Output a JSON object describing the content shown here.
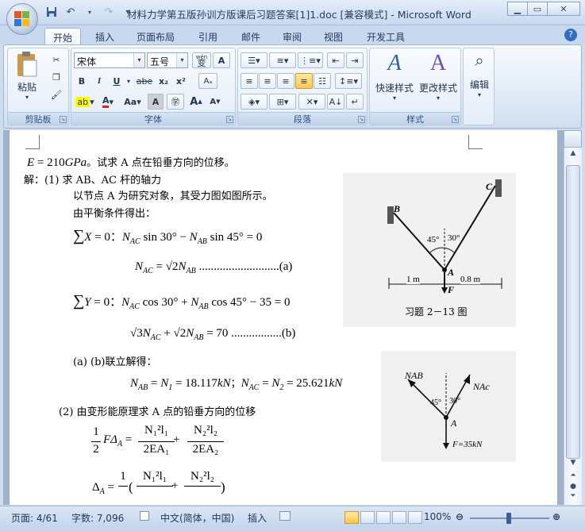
{
  "window": {
    "title": "材料力学第五版孙训方版课后习题答案[1]1.doc [兼容模式] - Microsoft Word"
  },
  "tabs": [
    "开始",
    "插入",
    "页面布局",
    "引用",
    "邮件",
    "审阅",
    "视图",
    "开发工具"
  ],
  "ribbon": {
    "clipboard": {
      "paste": "粘贴",
      "label": "剪贴板"
    },
    "font": {
      "family": "宋体",
      "size": "五号",
      "label": "字体",
      "wen": "wén",
      "wen_char": "变",
      "bold": "B",
      "italic": "I",
      "underline": "U",
      "strike": "abe",
      "sub": "x₂",
      "sup": "x²",
      "aa": "Aa",
      "grow": "A",
      "shrink": "A"
    },
    "paragraph": {
      "label": "段落"
    },
    "styles": {
      "quick": "快速样式",
      "change": "更改样式",
      "label": "样式"
    },
    "editing": {
      "label": "编辑"
    }
  },
  "document": {
    "line1_a": "E",
    "line1_b": " = 210",
    "line1_c": "GPa",
    "line1_d": "。试求 A 点在铅垂方向的位移。",
    "sol1": "解：(1) 求 AB、AC 杆的轴力",
    "sol2": "以节点 A 为研究对象，其受力图如图所示。",
    "sol3": "由平衡条件得出：",
    "eq1_a": "∑",
    "eq1_b": "X",
    "eq1_c": " = 0：",
    "eq1_d": "N",
    "eq1_e": "AC",
    "eq1_f": " sin 30° − ",
    "eq1_g": "N",
    "eq1_h": "AB",
    "eq1_i": " sin 45° = 0",
    "eq2_a": "N",
    "eq2_b": "AC",
    "eq2_c": " = √2",
    "eq2_d": "N",
    "eq2_e": "AB",
    "eq2_f": " ...........................(a)",
    "eq3_a": "∑",
    "eq3_b": "Y",
    "eq3_c": " = 0：",
    "eq3_d": "N",
    "eq3_e": "AC",
    "eq3_f": " cos 30° + ",
    "eq3_g": "N",
    "eq3_h": "AB",
    "eq3_i": " cos 45° − 35 = 0",
    "eq4_a": "√3",
    "eq4_b": "N",
    "eq4_c": "AC",
    "eq4_d": " + √2",
    "eq4_e": "N",
    "eq4_f": "AB",
    "eq4_g": " = 70 .................(b)",
    "sol4": "(a)  (b)联立解得：",
    "eq5_a": "N",
    "eq5_b": "AB",
    "eq5_c": " = ",
    "eq5_d": "N",
    "eq5_e": "1",
    "eq5_f": " = 18.117",
    "eq5_g": "kN",
    "eq5_h": "；",
    "eq5_i": "N",
    "eq5_j": "AC",
    "eq5_k": " = ",
    "eq5_l": "N",
    "eq5_m": "2",
    "eq5_n": " = 25.621",
    "eq5_o": "kN",
    "sol5": "(2) 由变形能原理求 A 点的铅垂方向的位移",
    "eq6_half": "1",
    "eq6_two": "2",
    "eq6_f": "FΔ",
    "eq6_fa": "A",
    "eq6_eq": " = ",
    "eq6_num1": "N₁²l₁",
    "eq6_den1": "2EA₁",
    "eq6_plus": " + ",
    "eq6_num2": "N₂²l₂",
    "eq6_den2": "2EA₂",
    "eq7_a": "Δ",
    "eq7_b": "A",
    "eq7_c": " = ",
    "eq7_one": "1",
    "eq7_open": "(",
    "eq7_num1": "N₁²l₁",
    "eq7_plus": " + ",
    "eq7_num2": "N₂²l₂",
    "eq7_close": ")"
  },
  "figure1": {
    "B": "B",
    "C": "C",
    "A": "A",
    "F": "F",
    "ang1": "45°",
    "ang2": "30°",
    "dim1": "1 m",
    "dim2": "0.8 m",
    "caption": "习题 2－13 图"
  },
  "figure2": {
    "nab": "NAB",
    "nac": "NAc",
    "a45": "45°",
    "a30": "30°",
    "A": "A",
    "force": "F=35kN"
  },
  "status": {
    "page": "页面: 4/61",
    "words": "字数: 7,096",
    "lang": "中文(简体，中国)",
    "mode": "插入",
    "zoom": "100%"
  }
}
